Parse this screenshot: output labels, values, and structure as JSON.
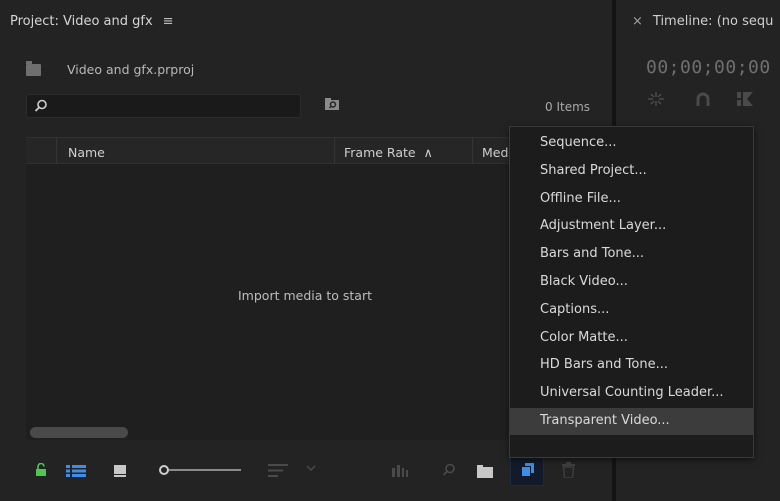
{
  "project": {
    "title": "Project: Video and gfx",
    "menu_glyph": "≡",
    "file_name": "Video and gfx.prproj",
    "search": {
      "value": "",
      "placeholder": ""
    },
    "items_count": "0 Items",
    "columns": [
      "Name",
      "Frame Rate",
      "Med"
    ],
    "sort_glyph": "∧",
    "empty_message": "Import media to start"
  },
  "timeline": {
    "close_glyph": "×",
    "title": "Timeline: (no sequ",
    "timecode": "00;00;00;00"
  },
  "new_item_menu": {
    "items": [
      "Sequence...",
      "Shared Project...",
      "Offline File...",
      "Adjustment Layer...",
      "Bars and Tone...",
      "Black Video...",
      "Captions...",
      "Color Matte...",
      "HD Bars and Tone...",
      "Universal Counting Leader...",
      "Transparent Video..."
    ],
    "hovered_index": 10
  },
  "colors": {
    "panel_bg": "#232323",
    "lock_green": "#4fc64f",
    "accent_blue": "#3b8eea",
    "menu_hover": "#3c3c3c"
  },
  "icons": {
    "lock": "lock-icon",
    "list_view": "list-view-icon",
    "icon_view": "icon-view-icon",
    "freeform_view": "freeform-view-icon",
    "sort": "sort-icon",
    "automate": "automate-to-sequence-icon",
    "find": "find-icon",
    "new_bin": "new-bin-icon",
    "new_item": "new-item-icon",
    "clear": "trash-icon",
    "search": "search-icon",
    "bin_search": "new-search-bin-icon"
  }
}
